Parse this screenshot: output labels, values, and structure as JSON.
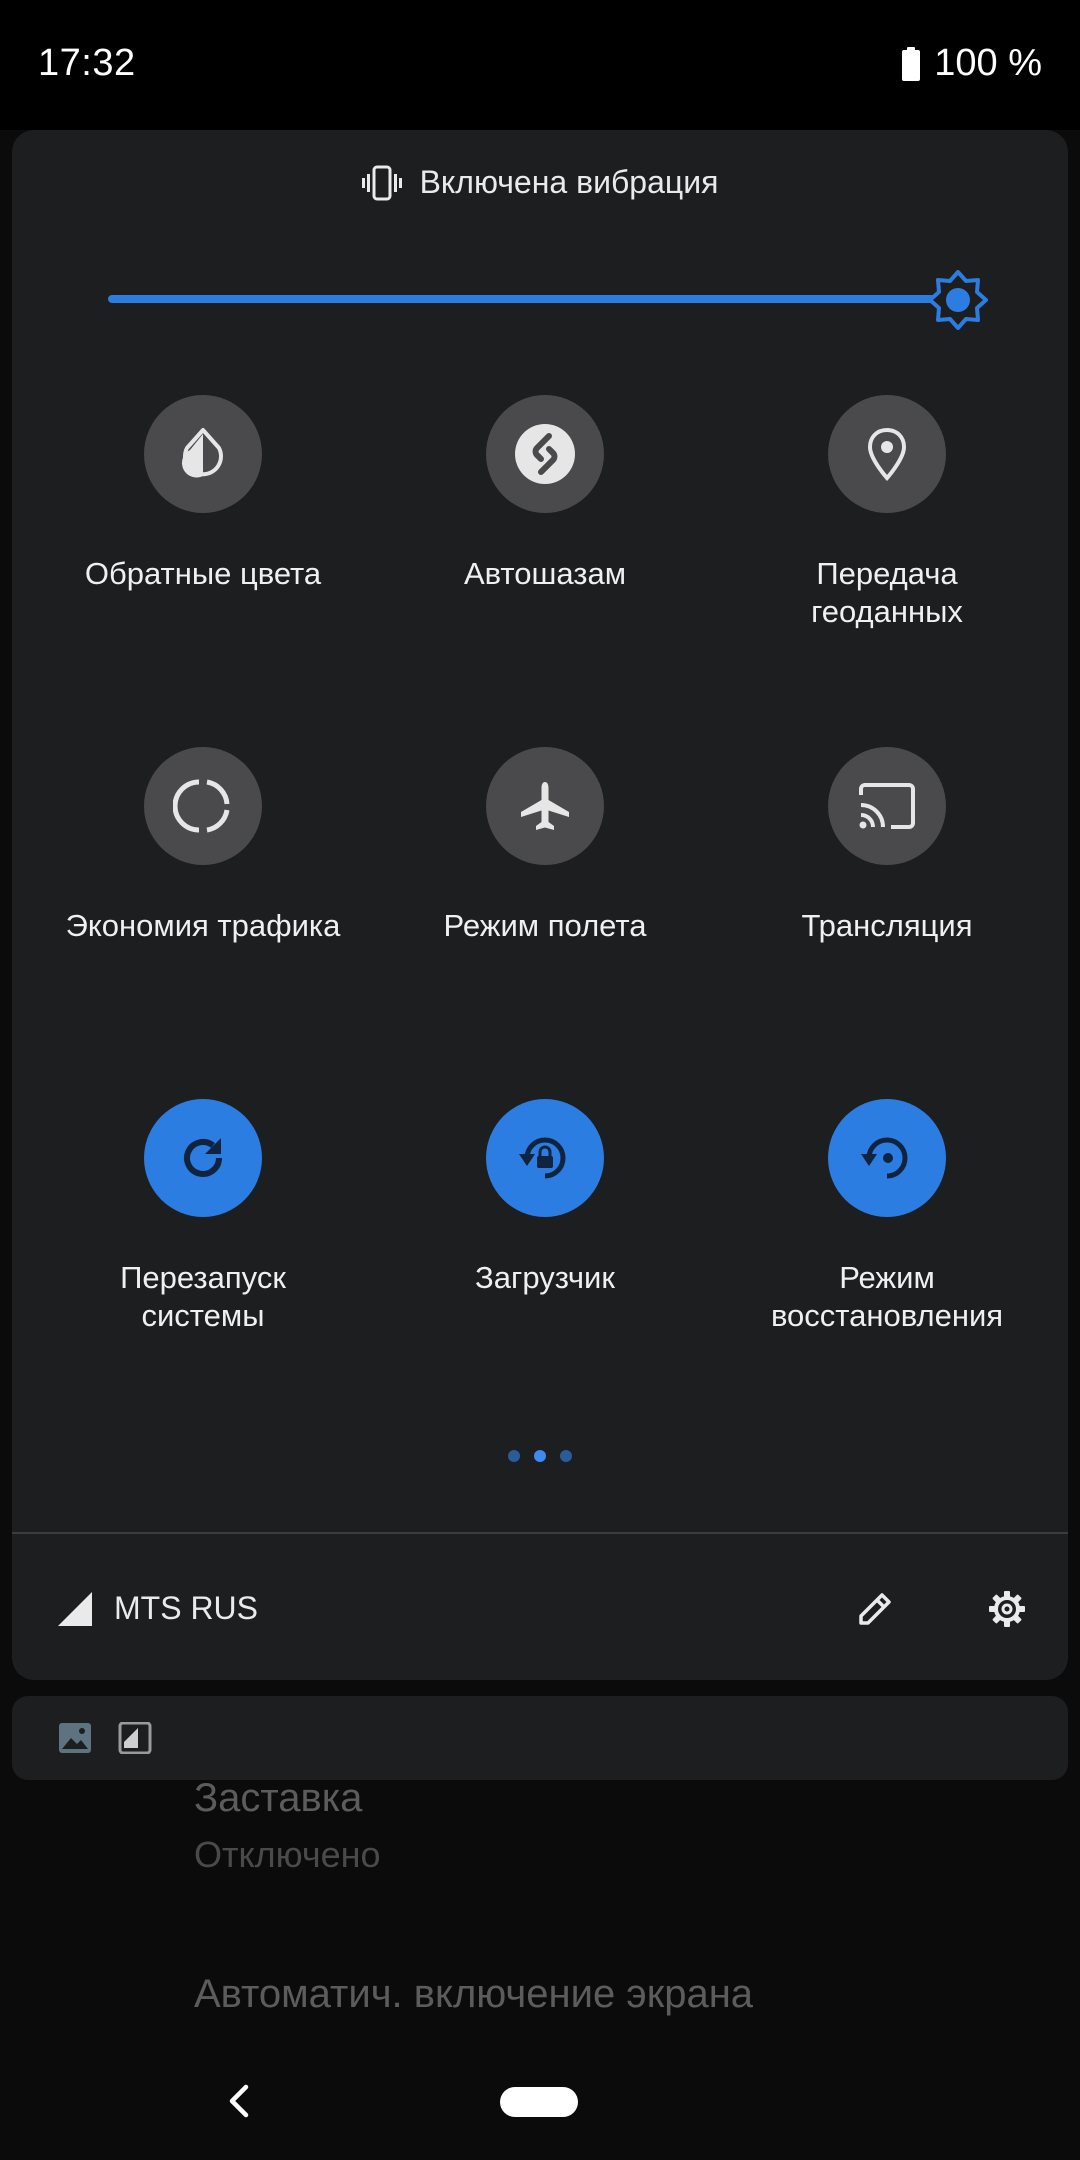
{
  "status_bar": {
    "time": "17:32",
    "battery": "100 %"
  },
  "background_settings": {
    "items": [
      {
        "title": "Заставка",
        "subtitle": "Отключено"
      },
      {
        "title": "Автоматич. включение экрана"
      }
    ]
  },
  "quick_settings": {
    "ringer_mode": {
      "icon": "vibrate-icon",
      "label": "Включена вибрация"
    },
    "brightness": {
      "level": 1.0,
      "color": "#2b7de1"
    },
    "tiles": [
      {
        "label": "Обратные цвета",
        "icon": "invert-colors-icon",
        "active": false
      },
      {
        "label": "Автошазам",
        "icon": "shazam-icon",
        "active": false
      },
      {
        "label": "Передача\nгеоданных",
        "icon": "location-icon",
        "active": false
      },
      {
        "label": "Экономия трафика",
        "icon": "data-saver-icon",
        "active": false
      },
      {
        "label": "Режим полета",
        "icon": "airplane-icon",
        "active": false
      },
      {
        "label": "Трансляция",
        "icon": "cast-icon",
        "active": false
      },
      {
        "label": "Перезапуск\nсистемы",
        "icon": "restart-icon",
        "active": true
      },
      {
        "label": "Загрузчик",
        "icon": "bootloader-lock-icon",
        "active": true
      },
      {
        "label": "Режим\nвосстановления",
        "icon": "recovery-icon",
        "active": true
      }
    ],
    "pages": {
      "count": 3,
      "current": 2
    },
    "carrier": "MTS RUS"
  },
  "colors": {
    "accent": "#2b7de1",
    "tile_inactive": "#4a4a4c",
    "panel": "#1d1e20"
  }
}
